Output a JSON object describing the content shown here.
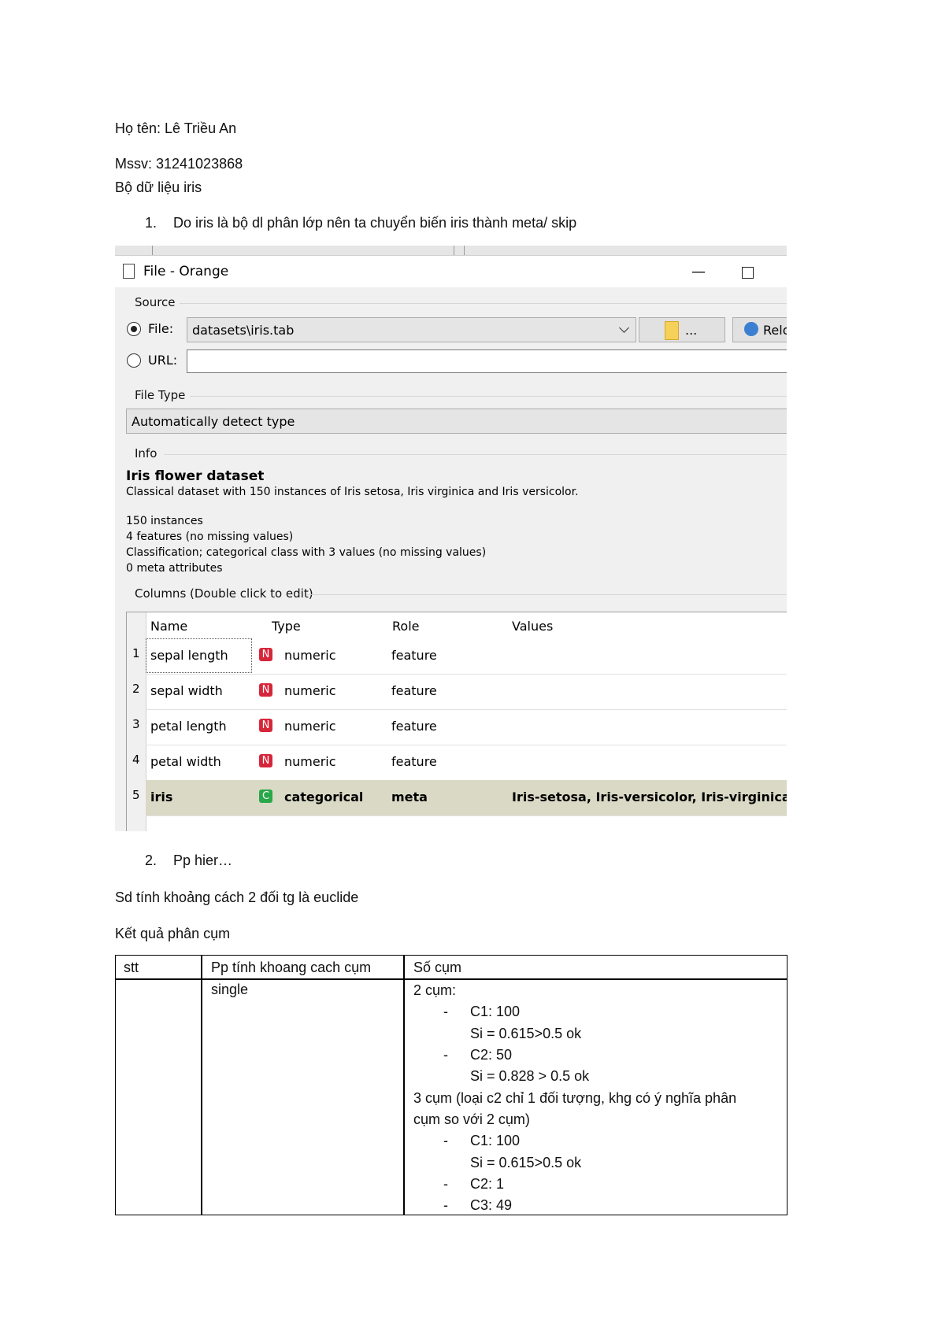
{
  "doc": {
    "name_line": "Họ tên: Lê Triều An",
    "mssv_line": "Mssv: 31241023868",
    "dataset_line": "Bộ dữ liệu iris",
    "step1": {
      "num": "1.",
      "text": "Do iris là bộ dl phân lớp nên ta chuyển biến iris thành meta/ skip"
    },
    "step2": {
      "num": "2.",
      "text": "Pp hier…"
    },
    "distance_line": "Sd tính khoảng cách 2 đối tg là euclide",
    "result_heading": "Kết quả phân cụm"
  },
  "orange": {
    "window_title": "File - Orange",
    "minimize": "—",
    "source_label": "Source",
    "file_label": "File:",
    "file_value": "datasets\\iris.tab",
    "browse_label": "...",
    "reload_label": "Relo",
    "url_label": "URL:",
    "filetype_label": "File Type",
    "filetype_value": "Automatically detect type",
    "info_label": "Info",
    "info_title": "Iris flower dataset",
    "info_desc": "Classical dataset with 150 instances of Iris setosa, Iris virginica and Iris versicolor.",
    "info_lines": [
      "150 instances",
      "4 features (no missing values)",
      "Classification; categorical class with 3 values (no missing values)",
      "0 meta attributes"
    ],
    "columns_label": "Columns (Double click to edit)",
    "headers": [
      "Name",
      "Type",
      "Role",
      "Values"
    ],
    "rows": [
      {
        "n": "1",
        "name": "sepal length",
        "badge": "N",
        "type": "numeric",
        "role": "feature",
        "values": ""
      },
      {
        "n": "2",
        "name": "sepal width",
        "badge": "N",
        "type": "numeric",
        "role": "feature",
        "values": ""
      },
      {
        "n": "3",
        "name": "petal length",
        "badge": "N",
        "type": "numeric",
        "role": "feature",
        "values": ""
      },
      {
        "n": "4",
        "name": "petal width",
        "badge": "N",
        "type": "numeric",
        "role": "feature",
        "values": ""
      },
      {
        "n": "5",
        "name": "iris",
        "badge": "C",
        "type": "categorical",
        "role": "meta",
        "values": "Iris-setosa, Iris-versicolor, Iris-virginica"
      }
    ],
    "colors": {
      "numeric_badge": "#d6263a",
      "categorical_badge": "#29a84a",
      "selected_row": "#d9d9c5"
    }
  },
  "result_table": {
    "headers": [
      "stt",
      "Pp tính khoang cach cụm",
      "Số cụm"
    ],
    "method": "single",
    "lines": [
      "2 cụm:",
      "-",
      "C1: 100",
      "Si = 0.615>0.5 ok",
      "-",
      "C2: 50",
      "Si = 0.828 > 0.5 ok",
      "3 cụm (loại c2 chỉ 1 đối tượng, khg có ý nghĩa phân",
      "cụm so với 2 cụm)",
      "-",
      "C1: 100",
      "Si = 0.615>0.5 ok",
      "-",
      "C2: 1",
      "-",
      "C3: 49"
    ]
  }
}
